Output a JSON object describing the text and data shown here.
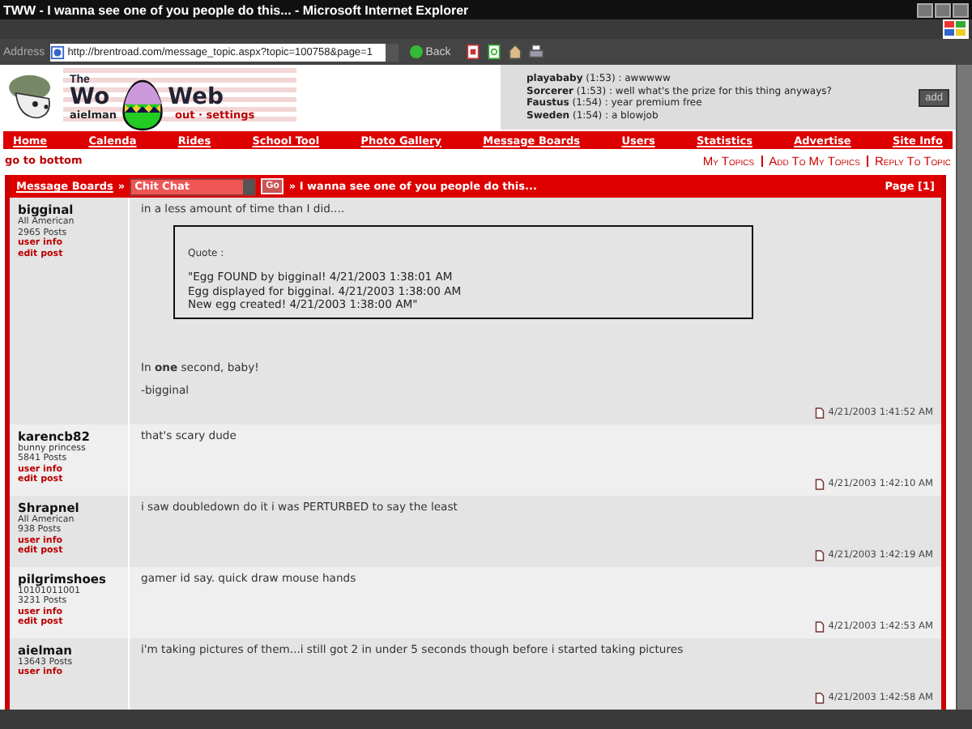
{
  "window": {
    "title": "TWW - I wanna see one of you people do this... - Microsoft Internet Explorer"
  },
  "address_bar": {
    "label": "Address",
    "url": "http://brentroad.com/message_topic.aspx?topic=100758&page=1",
    "back": "Back"
  },
  "header": {
    "logo_top": "The",
    "logo_left": "Wo",
    "logo_right": "Web",
    "user": "aielman",
    "user_links": "out · settings",
    "chat": [
      {
        "user": "playababy",
        "time": "(1:53)",
        "text": ": awwwww"
      },
      {
        "user": "Sorcerer",
        "time": "(1:53)",
        "text": ": well what's the prize for this thing anyways?"
      },
      {
        "user": "Faustus",
        "time": "(1:54)",
        "text": ": year premium free"
      },
      {
        "user": "Sweden",
        "time": "(1:54)",
        "text": ": a blowjob"
      }
    ],
    "chat_button": "add"
  },
  "nav": [
    "Home",
    "Calenda",
    "Rides",
    "School Tool",
    "Photo Gallery",
    "Message Boards",
    "Users",
    "Statistics",
    "Advertise",
    "Site Info"
  ],
  "subnav": {
    "go_to_bottom": "go to bottom",
    "actions": [
      "My Topics",
      "Add To My Topics",
      "Reply To Topic"
    ]
  },
  "board_bar": {
    "boards_link": "Message Boards",
    "separator": "»",
    "board": "Chit Chat",
    "go": "Go",
    "topic": "» I wanna see one of you people do this...",
    "page": "Page [1]"
  },
  "posts": [
    {
      "author": "bigginal",
      "title": "All American",
      "count": "2965 Posts",
      "links": [
        "user info",
        "edit post"
      ],
      "body": [
        {
          "kind": "text",
          "text": "in a less amount of time than I did...."
        },
        {
          "kind": "quote",
          "label": "Quote :",
          "lines": [
            "\"Egg FOUND by bigginal! 4/21/2003 1:38:01 AM",
            "Egg displayed for bigginal. 4/21/2003 1:38:00 AM",
            "New egg created! 4/21/2003 1:38:00 AM\""
          ]
        },
        {
          "kind": "text",
          "text": "In **one** second, baby!"
        },
        {
          "kind": "text",
          "text": "-bigginal"
        }
      ],
      "time": "4/21/2003 1:41:52 AM"
    },
    {
      "author": "karencb82",
      "title": "bunny princess",
      "count": "5841 Posts",
      "links": [
        "user info",
        "edit post"
      ],
      "body": [
        {
          "kind": "text",
          "text": "that's scary dude"
        }
      ],
      "time": "4/21/2003 1:42:10 AM"
    },
    {
      "author": "Shrapnel",
      "title": "All American",
      "count": "938 Posts",
      "links": [
        "user info",
        "edit post"
      ],
      "body": [
        {
          "kind": "text",
          "text": "i saw doubledown do it i was PERTURBED to say the least"
        }
      ],
      "time": "4/21/2003 1:42:19 AM"
    },
    {
      "author": "pilgrimshoes",
      "title": "10101011001",
      "count": "3231 Posts",
      "links": [
        "user info",
        "edit post"
      ],
      "body": [
        {
          "kind": "text",
          "text": "gamer id say. quick draw mouse hands"
        }
      ],
      "time": "4/21/2003 1:42:53 AM"
    },
    {
      "author": "aielman",
      "count": "13643 Posts",
      "links": [
        "user info"
      ],
      "body": [
        {
          "kind": "text",
          "text": "i'm taking pictures of them...i still got 2 in under 5 seconds though before i started taking pictures"
        }
      ],
      "time": "4/21/2003 1:42:58 AM"
    }
  ]
}
